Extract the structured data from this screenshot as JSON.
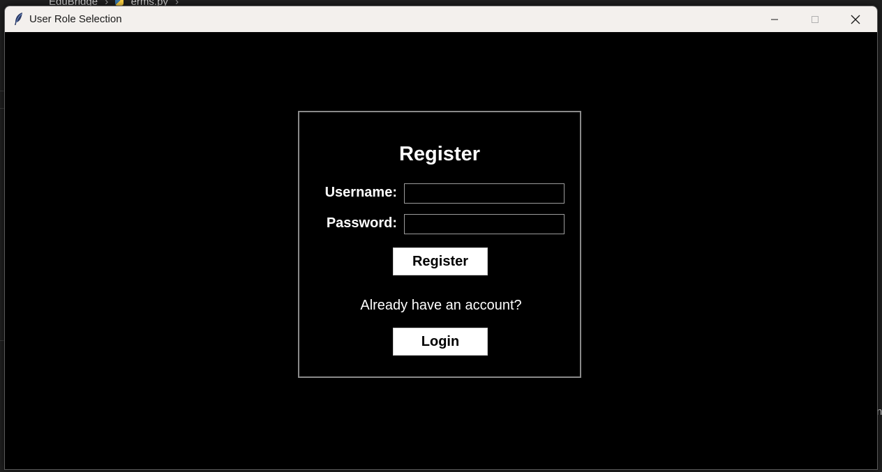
{
  "background": {
    "breadcrumb": [
      "EduBridge",
      "erms.py"
    ],
    "edge_text": "n"
  },
  "window": {
    "title": "User Role Selection",
    "icon": "feather-icon",
    "controls": [
      "minimize-icon",
      "maximize-icon",
      "close-icon"
    ]
  },
  "form": {
    "heading": "Register",
    "username_label": "Username:",
    "username_value": "",
    "password_label": "Password:",
    "password_value": "",
    "register_button": "Register",
    "account_prompt": "Already have an account?",
    "login_button": "Login"
  },
  "colors": {
    "window_background": "#000000",
    "titlebar": "#f3f0ed",
    "button_background": "#ffffff",
    "text": "#ffffff"
  }
}
